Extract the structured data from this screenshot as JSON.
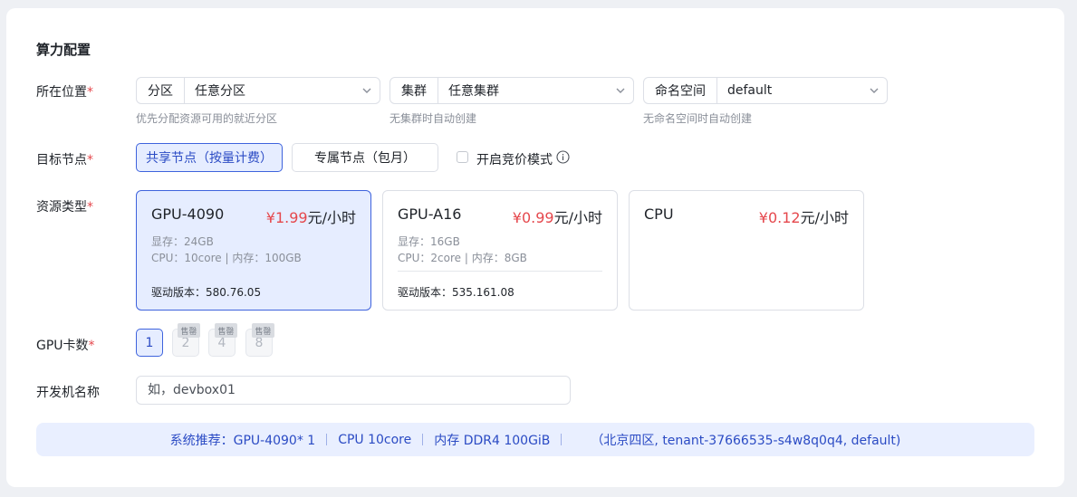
{
  "section_title": "算力配置",
  "location": {
    "label": "所在位置",
    "required_mark": "*",
    "partition": {
      "prefix": "分区",
      "value": "任意分区",
      "hint": "优先分配资源可用的就近分区"
    },
    "cluster": {
      "prefix": "集群",
      "value": "任意集群",
      "hint": "无集群时自动创建"
    },
    "namespace": {
      "prefix": "命名空间",
      "value": "default",
      "hint": "无命名空间时自动创建"
    }
  },
  "target_node": {
    "label": "目标节点",
    "required_mark": "*",
    "shared": "共享节点（按量计费）",
    "dedicated": "专属节点（包月）",
    "bidding": "开启竞价模式",
    "selected": "shared",
    "bidding_checked": false
  },
  "resource_type": {
    "label": "资源类型",
    "required_mark": "*",
    "cards": [
      {
        "name": "GPU-4090",
        "price": "¥1.99",
        "unit": "元/小时",
        "memory": "显存：24GB",
        "cpu": "CPU：10core | 内存：100GB",
        "driver": "驱动版本：580.76.05",
        "selected": true
      },
      {
        "name": "GPU-A16",
        "price": "¥0.99",
        "unit": "元/小时",
        "memory": "显存：16GB",
        "cpu": "CPU：2core | 内存：8GB",
        "driver": "驱动版本：535.161.08",
        "selected": false
      },
      {
        "name": "CPU",
        "price": "¥0.12",
        "unit": "元/小时",
        "selected": false
      }
    ]
  },
  "gpu_count": {
    "label": "GPU卡数",
    "required_mark": "*",
    "options": [
      "1",
      "2",
      "4",
      "8"
    ],
    "sold_out_label": "售罄",
    "selected": "1"
  },
  "devbox_name": {
    "label": "开发机名称",
    "placeholder": "如，devbox01"
  },
  "recommendation": {
    "gpu": "系统推荐：GPU-4090* 1",
    "cpu": "CPU 10core",
    "memory": "内存 DDR4 100GiB",
    "location": "（北京四区, tenant-37666535-s4w8q0q4, default)"
  },
  "colors": {
    "accent": "#3e63dd",
    "accent_bg": "#e6edff",
    "price": "#e5484d",
    "required": "#e5484d"
  }
}
